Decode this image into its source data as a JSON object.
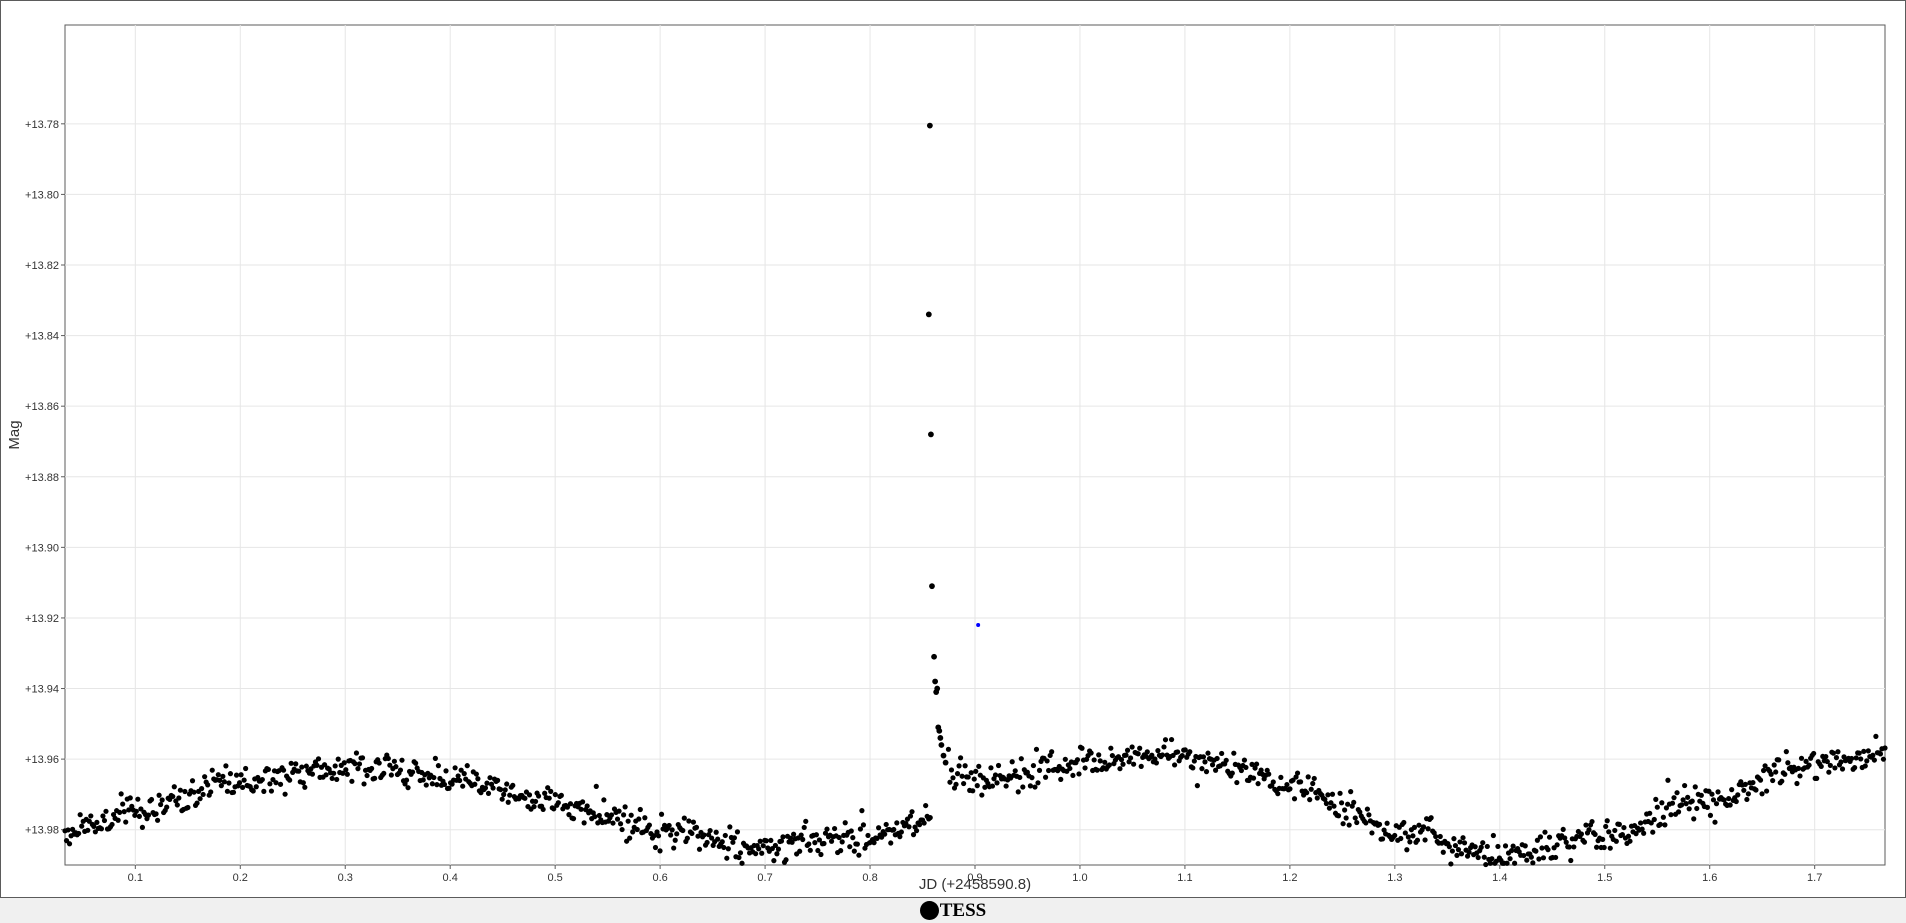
{
  "chart_data": {
    "type": "scatter",
    "title": "",
    "xlabel": "JD (+2458590.8)",
    "ylabel": "Mag",
    "xlim": [
      0.033,
      1.767
    ],
    "ylim": [
      13.99,
      13.752
    ],
    "y_inverted": true,
    "grid": true,
    "x_ticks": [
      0.1,
      0.2,
      0.3,
      0.4,
      0.5,
      0.6,
      0.7,
      0.8,
      0.9,
      1.0,
      1.1,
      1.2,
      1.3,
      1.4,
      1.5,
      1.6,
      1.7
    ],
    "x_tick_labels": [
      "0.1",
      "0.2",
      "0.3",
      "0.4",
      "0.5",
      "0.6",
      "0.7",
      "0.8",
      "0.9",
      "1.0",
      "1.1",
      "1.2",
      "1.3",
      "1.4",
      "1.5",
      "1.6",
      "1.7"
    ],
    "y_ticks": [
      13.78,
      13.8,
      13.82,
      13.84,
      13.86,
      13.88,
      13.9,
      13.92,
      13.94,
      13.96,
      13.98
    ],
    "y_tick_labels": [
      "+13.78",
      "+13.80",
      "+13.82",
      "+13.84",
      "+13.86",
      "+13.88",
      "+13.90",
      "+13.92",
      "+13.94",
      "+13.96",
      "+13.98"
    ],
    "legend": {
      "placement": "bottom-center",
      "entries": [
        "TESS"
      ]
    },
    "series": [
      {
        "name": "TESS",
        "color": "#000000",
        "x_start": 0.033,
        "x_end": 1.767,
        "sample_count": 1200,
        "baseline_nodes": {
          "x": [
            0.033,
            0.1,
            0.2,
            0.3,
            0.4,
            0.5,
            0.6,
            0.7,
            0.8,
            0.855,
            0.875,
            0.9,
            1.0,
            1.08,
            1.15,
            1.2,
            1.3,
            1.4,
            1.5,
            1.6,
            1.7,
            1.767
          ],
          "y": [
            13.981,
            13.975,
            13.966,
            13.962,
            13.965,
            13.973,
            13.98,
            13.985,
            13.982,
            13.978,
            13.963,
            13.966,
            13.961,
            13.959,
            13.962,
            13.967,
            13.98,
            13.988,
            13.982,
            13.971,
            13.961,
            13.958
          ]
        },
        "scatter_amplitude": 0.0022,
        "gap": [
          0.858,
          0.874
        ],
        "flare_points": [
          {
            "x": 0.857,
            "y": 13.7805
          },
          {
            "x": 0.856,
            "y": 13.834
          },
          {
            "x": 0.858,
            "y": 13.868
          },
          {
            "x": 0.859,
            "y": 13.911
          },
          {
            "x": 0.861,
            "y": 13.931
          },
          {
            "x": 0.862,
            "y": 13.938
          },
          {
            "x": 0.863,
            "y": 13.941
          },
          {
            "x": 0.864,
            "y": 13.94
          },
          {
            "x": 0.865,
            "y": 13.951
          },
          {
            "x": 0.866,
            "y": 13.952
          },
          {
            "x": 0.867,
            "y": 13.954
          },
          {
            "x": 0.868,
            "y": 13.956
          },
          {
            "x": 0.87,
            "y": 13.959
          },
          {
            "x": 0.872,
            "y": 13.961
          }
        ]
      },
      {
        "name": "",
        "color": "#0000ff",
        "points": [
          {
            "x": 0.903,
            "y": 13.922
          }
        ]
      }
    ]
  }
}
